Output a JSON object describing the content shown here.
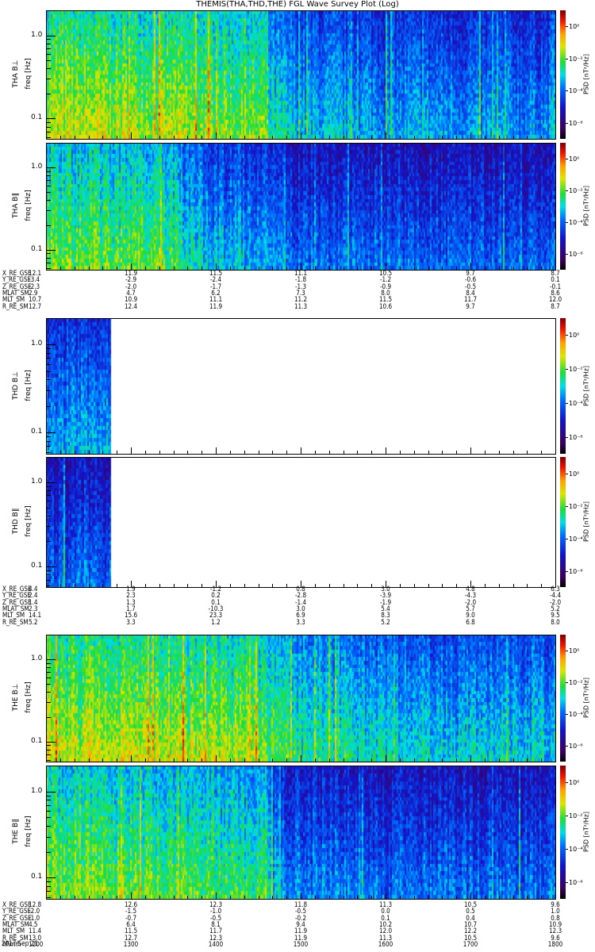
{
  "title": "THEMIS(THA,THD,THE) FGL Wave Survey Plot (Log)",
  "colors": {
    "background": "#ffffff",
    "axes": "#000000"
  },
  "chart_data": {
    "type": "heatmap",
    "title": "THEMIS(THA,THD,THE) FGL Wave Survey Plot (Log)",
    "x_axis": {
      "label": "hhmm",
      "date": "2017 Sep 21",
      "range": [
        "1200",
        "1800"
      ],
      "ticks": [
        "1200",
        "1300",
        "1400",
        "1500",
        "1600",
        "1700",
        "1800"
      ]
    },
    "y_axis": {
      "label": "freq [Hz]",
      "scale": "log",
      "range": [
        0.057,
        2.0
      ],
      "tick_labels": [
        "1.0",
        "0.1"
      ]
    },
    "colorbar": {
      "label": "PSD [nT²/Hz]",
      "scale": "log",
      "range_log10": [
        -7,
        1
      ],
      "tick_labels": [
        "10⁰",
        "10⁻²",
        "10⁻⁴",
        "10⁻⁶"
      ]
    },
    "panels": [
      {
        "id": "tha_bperp",
        "ylabel": "THA B⊥",
        "hourly_mean_log10_psd": [
          -2.0,
          -2.1,
          -2.3,
          -3.8,
          -4.0,
          -4.1
        ],
        "data_hours": [
          0,
          6
        ]
      },
      {
        "id": "tha_bpar",
        "ylabel": "THA B∥",
        "hourly_mean_log10_psd": [
          -2.5,
          -2.6,
          -3.8,
          -4.5,
          -4.6,
          -4.6
        ],
        "data_hours": [
          0,
          6
        ]
      },
      {
        "id": "thd_bperp",
        "ylabel": "THD B⊥",
        "hourly_mean_log10_psd": [
          -4.0
        ],
        "data_hours": [
          0,
          0.75
        ]
      },
      {
        "id": "thd_bpar",
        "ylabel": "THD B∥",
        "hourly_mean_log10_psd": [
          -4.6
        ],
        "data_hours": [
          0,
          0.75
        ]
      },
      {
        "id": "the_bperp",
        "ylabel": "THE B⊥",
        "hourly_mean_log10_psd": [
          -1.9,
          -2.0,
          -2.1,
          -3.0,
          -3.5,
          -3.6
        ],
        "data_hours": [
          0,
          6
        ]
      },
      {
        "id": "the_bpar",
        "ylabel": "THE B∥",
        "hourly_mean_log10_psd": [
          -2.3,
          -2.5,
          -2.8,
          -4.3,
          -4.5,
          -4.5
        ],
        "data_hours": [
          0,
          6
        ]
      }
    ]
  },
  "ephemeris": [
    {
      "rows": [
        {
          "label": "X_RE_GSE",
          "values": [
            "12.1",
            "11.9",
            "11.5",
            "11.1",
            "10.5",
            "9.7",
            "8.7"
          ]
        },
        {
          "label": "Y_RE_GSE",
          "values": [
            "-3.4",
            "-2.9",
            "-2.4",
            "-1.8",
            "-1.2",
            "-0.6",
            "0.1"
          ]
        },
        {
          "label": "Z_RE_GSE",
          "values": [
            "-2.3",
            "-2.0",
            "-1.7",
            "-1.3",
            "-0.9",
            "-0.5",
            "-0.1"
          ]
        },
        {
          "label": "MLAT_SM",
          "values": [
            "2.9",
            "4.7",
            "6.2",
            "7.3",
            "8.0",
            "8.4",
            "8.6"
          ]
        },
        {
          "label": "MLT_SM",
          "values": [
            "10.7",
            "10.9",
            "11.1",
            "11.2",
            "11.5",
            "11.7",
            "12.0"
          ]
        },
        {
          "label": "R_RE_SM",
          "values": [
            "12.7",
            "12.4",
            "11.9",
            "11.3",
            "10.6",
            "9.7",
            "8.7"
          ]
        }
      ]
    },
    {
      "rows": [
        {
          "label": "X_RE_GSE",
          "values": [
            "4.4",
            "1.9",
            "-1.2",
            "0.8",
            "3.0",
            "4.8",
            "6.3"
          ]
        },
        {
          "label": "Y_RE_GSE",
          "values": [
            "2.4",
            "2.3",
            "0.2",
            "-2.8",
            "-3.9",
            "-4.3",
            "-4.4"
          ]
        },
        {
          "label": "Z_RE_GSE",
          "values": [
            "1.4",
            "1.3",
            "0.1",
            "-1.4",
            "-1.9",
            "-2.0",
            "-2.0"
          ]
        },
        {
          "label": "MLAT_SM",
          "values": [
            "2.3",
            "1.7",
            "-10.3",
            "3.0",
            "5.4",
            "5.7",
            "5.2"
          ]
        },
        {
          "label": "MLT_SM",
          "values": [
            "14.1",
            "15.6",
            "23.3",
            "6.9",
            "8.3",
            "9.0",
            "9.5"
          ]
        },
        {
          "label": "R_RE_SM",
          "values": [
            "5.2",
            "3.3",
            "1.2",
            "3.3",
            "5.2",
            "6.8",
            "8.0"
          ]
        }
      ]
    },
    {
      "rows": [
        {
          "label": "X_RE_GSE",
          "values": [
            "12.8",
            "12.6",
            "12.3",
            "11.8",
            "11.3",
            "10.5",
            "9.6"
          ]
        },
        {
          "label": "Y_RE_GSE",
          "values": [
            "-2.0",
            "-1.5",
            "-1.0",
            "-0.5",
            "0.0",
            "0.5",
            "1.0"
          ]
        },
        {
          "label": "Z_RE_GSE",
          "values": [
            "-1.0",
            "-0.7",
            "-0.5",
            "-0.2",
            "0.1",
            "0.4",
            "0.8"
          ]
        },
        {
          "label": "MLAT_SM",
          "values": [
            "4.5",
            "6.4",
            "8.1",
            "9.4",
            "10.2",
            "10.7",
            "10.9"
          ]
        },
        {
          "label": "MLT_SM",
          "values": [
            "11.4",
            "11.5",
            "11.7",
            "11.9",
            "12.0",
            "12.2",
            "12.3"
          ]
        },
        {
          "label": "R_RE_SM",
          "values": [
            "13.0",
            "12.7",
            "12.3",
            "11.9",
            "11.3",
            "10.5",
            "9.6"
          ]
        },
        {
          "label": "hhmm",
          "values": [
            "1200",
            "1300",
            "1400",
            "1500",
            "1600",
            "1700",
            "1800"
          ]
        }
      ]
    }
  ],
  "date_label": "2017 Sep 21"
}
